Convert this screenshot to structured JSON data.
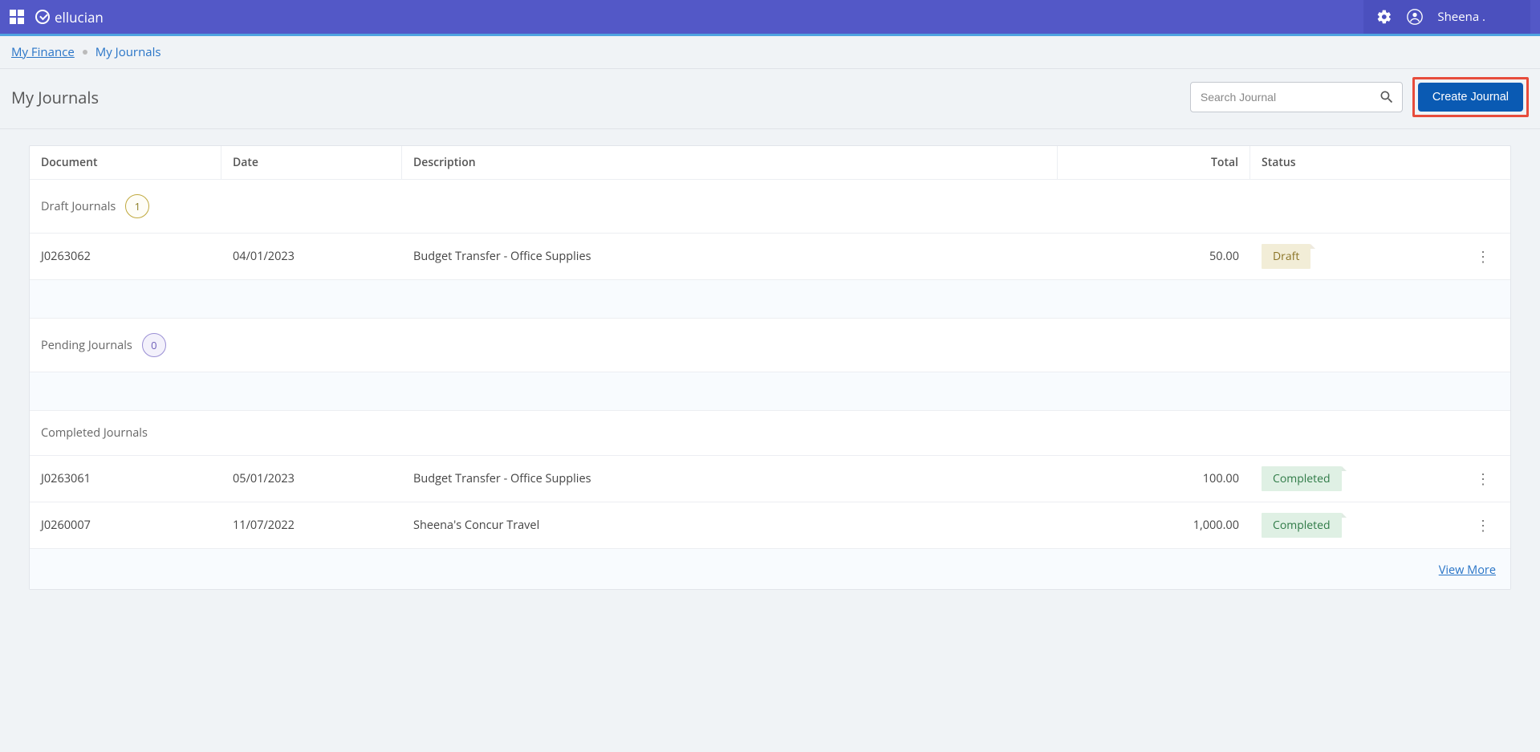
{
  "brand": "ellucian",
  "user_name": "Sheena .",
  "breadcrumb": {
    "root": "My Finance",
    "current": "My Journals"
  },
  "page_title": "My Journals",
  "search_placeholder": "Search Journal",
  "create_button": "Create Journal",
  "columns": {
    "document": "Document",
    "date": "Date",
    "description": "Description",
    "total": "Total",
    "status": "Status"
  },
  "sections": {
    "draft": {
      "label": "Draft Journals",
      "count": "1"
    },
    "pending": {
      "label": "Pending Journals",
      "count": "0"
    },
    "completed": {
      "label": "Completed Journals"
    }
  },
  "rows": {
    "draft": [
      {
        "document": "J0263062",
        "date": "04/01/2023",
        "description": "Budget Transfer - Office Supplies",
        "total": "50.00",
        "status": "Draft"
      }
    ],
    "completed": [
      {
        "document": "J0263061",
        "date": "05/01/2023",
        "description": "Budget Transfer - Office Supplies",
        "total": "100.00",
        "status": "Completed"
      },
      {
        "document": "J0260007",
        "date": "11/07/2022",
        "description": "Sheena's Concur Travel",
        "total": "1,000.00",
        "status": "Completed"
      }
    ]
  },
  "view_more": "View More"
}
